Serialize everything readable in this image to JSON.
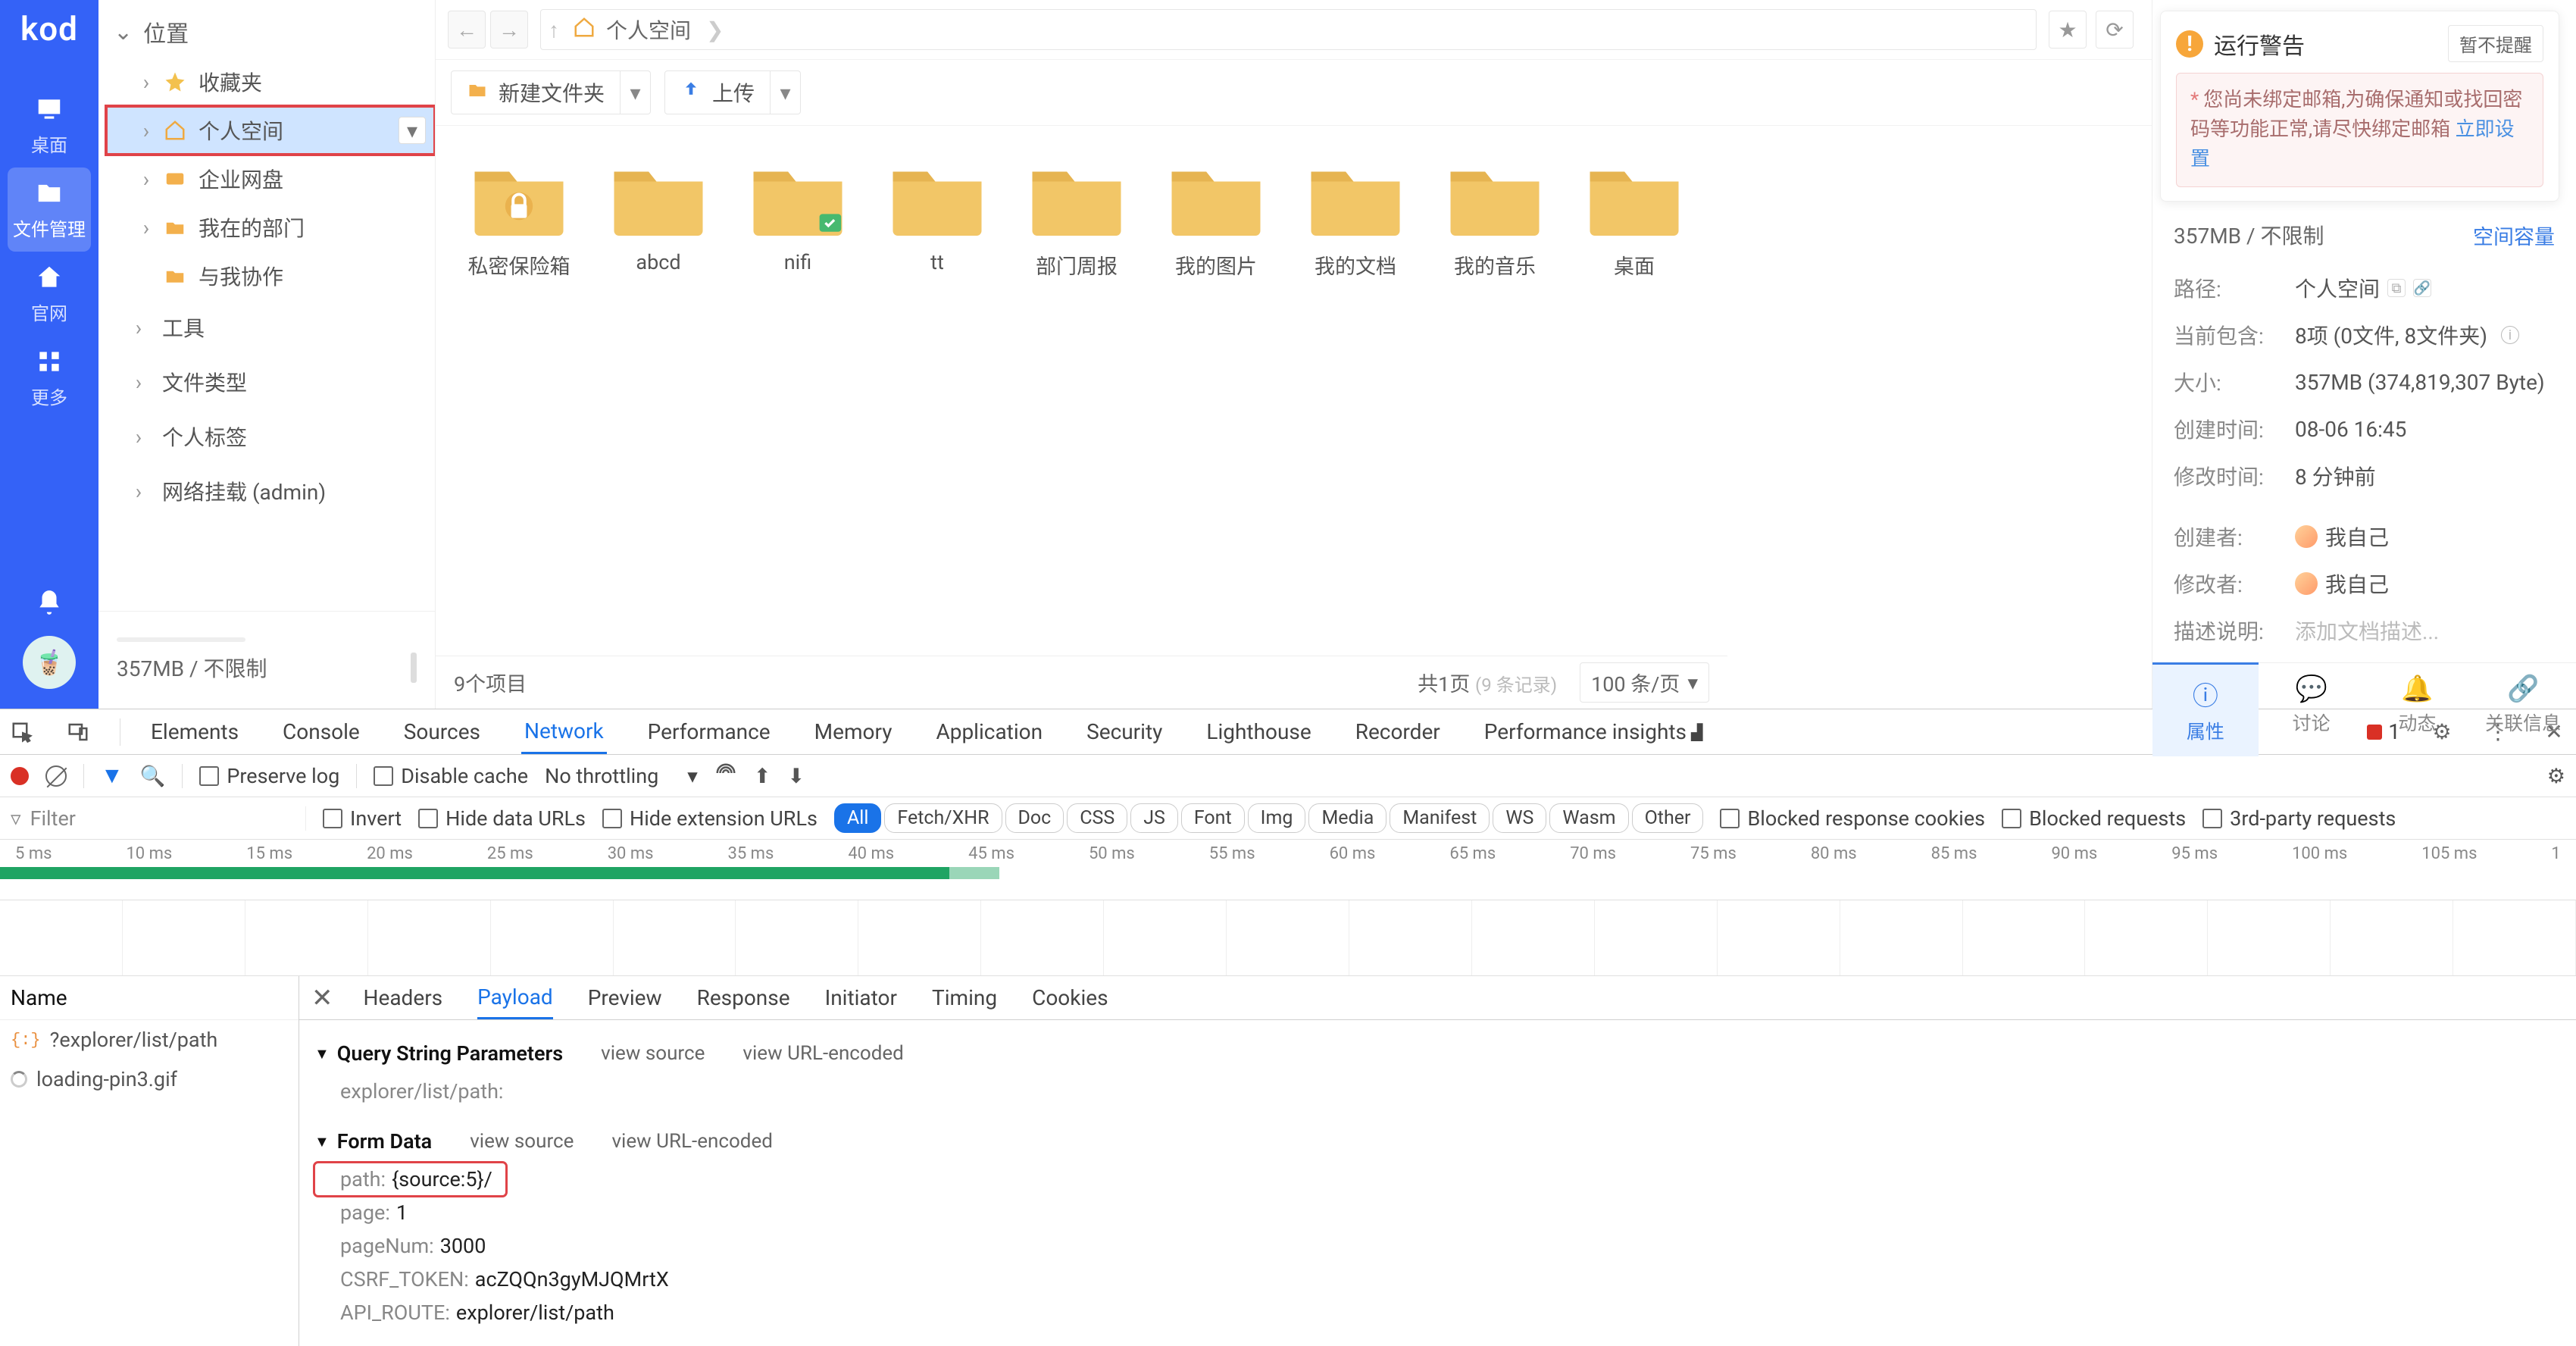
{
  "left_nav": {
    "logo": "kod",
    "items": [
      {
        "icon": "desktop",
        "label": "桌面"
      },
      {
        "icon": "folder",
        "label": "文件管理"
      },
      {
        "icon": "home",
        "label": "官网"
      },
      {
        "icon": "apps",
        "label": "更多"
      }
    ]
  },
  "sidebar": {
    "header": "位置",
    "items": [
      {
        "icon": "star",
        "label": "收藏夹"
      },
      {
        "icon": "home",
        "label": "个人空间",
        "selected": true
      },
      {
        "icon": "disk",
        "label": "企业网盘"
      },
      {
        "icon": "dept",
        "label": "我在的部门"
      },
      {
        "icon": "share",
        "label": "与我协作"
      }
    ],
    "sections": [
      "工具",
      "文件类型",
      "个人标签",
      "网络挂载 (admin)"
    ],
    "footer": "357MB / 不限制"
  },
  "breadcrumb": {
    "path": "个人空间"
  },
  "toolbar": {
    "new_folder": "新建文件夹",
    "upload": "上传"
  },
  "folders": [
    {
      "name": "私密保险箱",
      "variant": "lock"
    },
    {
      "name": "abcd"
    },
    {
      "name": "nifi",
      "badge": "share"
    },
    {
      "name": "tt"
    },
    {
      "name": "部门周报"
    },
    {
      "name": "我的图片"
    },
    {
      "name": "我的文档"
    },
    {
      "name": "我的音乐"
    },
    {
      "name": "桌面"
    }
  ],
  "pager": {
    "count": "9个项目",
    "page_info": "共1页",
    "page_muted": "(9 条记录)",
    "per_page": "100 条/页"
  },
  "info": {
    "storage": "357MB / 不限制",
    "capacity_link": "空间容量",
    "rows": [
      {
        "k": "路径:",
        "v": "个人空间",
        "icons": true
      },
      {
        "k": "当前包含:",
        "v": "8项 (0文件, 8文件夹)",
        "q": true
      },
      {
        "k": "大小:",
        "v": "357MB (374,819,307 Byte)"
      },
      {
        "k": "创建时间:",
        "v": "08-06 16:45"
      },
      {
        "k": "修改时间:",
        "v": "8 分钟前"
      },
      {
        "k": "创建者:",
        "v": "我自己",
        "user": true,
        "spaced": true
      },
      {
        "k": "修改者:",
        "v": "我自己",
        "user": true
      },
      {
        "k": "描述说明:",
        "v": "添加文档描述...",
        "placeholder": true
      }
    ],
    "tabs": [
      "属性",
      "讨论",
      "动态",
      "关联信息"
    ]
  },
  "toast": {
    "title": "运行警告",
    "dismiss": "暂不提醒",
    "msg": "您尚未绑定邮箱,为确保通知或找回密码等功能正常,请尽快绑定邮箱",
    "link": "立即设置"
  },
  "devtools": {
    "tabs": [
      "Elements",
      "Console",
      "Sources",
      "Network",
      "Performance",
      "Memory",
      "Application",
      "Security",
      "Lighthouse",
      "Recorder",
      "Performance insights"
    ],
    "issues_count": "1",
    "toolbar": {
      "preserve_log": "Preserve log",
      "disable_cache": "Disable cache",
      "throttling": "No throttling"
    },
    "filter": {
      "placeholder": "Filter",
      "invert": "Invert",
      "hide_data": "Hide data URLs",
      "hide_ext": "Hide extension URLs",
      "chips": [
        "All",
        "Fetch/XHR",
        "Doc",
        "CSS",
        "JS",
        "Font",
        "Img",
        "Media",
        "Manifest",
        "WS",
        "Wasm",
        "Other"
      ],
      "blocked_cookies": "Blocked response cookies",
      "blocked_req": "Blocked requests",
      "third_party": "3rd-party requests"
    },
    "timeline_ticks": [
      "5 ms",
      "10 ms",
      "15 ms",
      "20 ms",
      "25 ms",
      "30 ms",
      "35 ms",
      "40 ms",
      "45 ms",
      "50 ms",
      "55 ms",
      "60 ms",
      "65 ms",
      "70 ms",
      "75 ms",
      "80 ms",
      "85 ms",
      "90 ms",
      "95 ms",
      "100 ms",
      "105 ms",
      "1"
    ],
    "reqlist": {
      "header": "Name",
      "rows": [
        {
          "icon": "json",
          "name": "?explorer/list/path"
        },
        {
          "icon": "load",
          "name": "loading-pin3.gif"
        }
      ]
    },
    "detail_tabs": [
      "Headers",
      "Payload",
      "Preview",
      "Response",
      "Initiator",
      "Timing",
      "Cookies"
    ],
    "query_section": "Query String Parameters",
    "query_rows": [
      {
        "k": "",
        "v": "explorer/list/path:"
      }
    ],
    "view_source": "view source",
    "view_encoded": "view URL-encoded",
    "form_section": "Form Data",
    "form_rows": [
      {
        "k": "path:",
        "v": "{source:5}/",
        "hl": true
      },
      {
        "k": "page:",
        "v": "1"
      },
      {
        "k": "pageNum:",
        "v": "3000"
      },
      {
        "k": "CSRF_TOKEN:",
        "v": "acZQQn3gyMJQMrtX"
      },
      {
        "k": "API_ROUTE:",
        "v": "explorer/list/path"
      }
    ]
  }
}
